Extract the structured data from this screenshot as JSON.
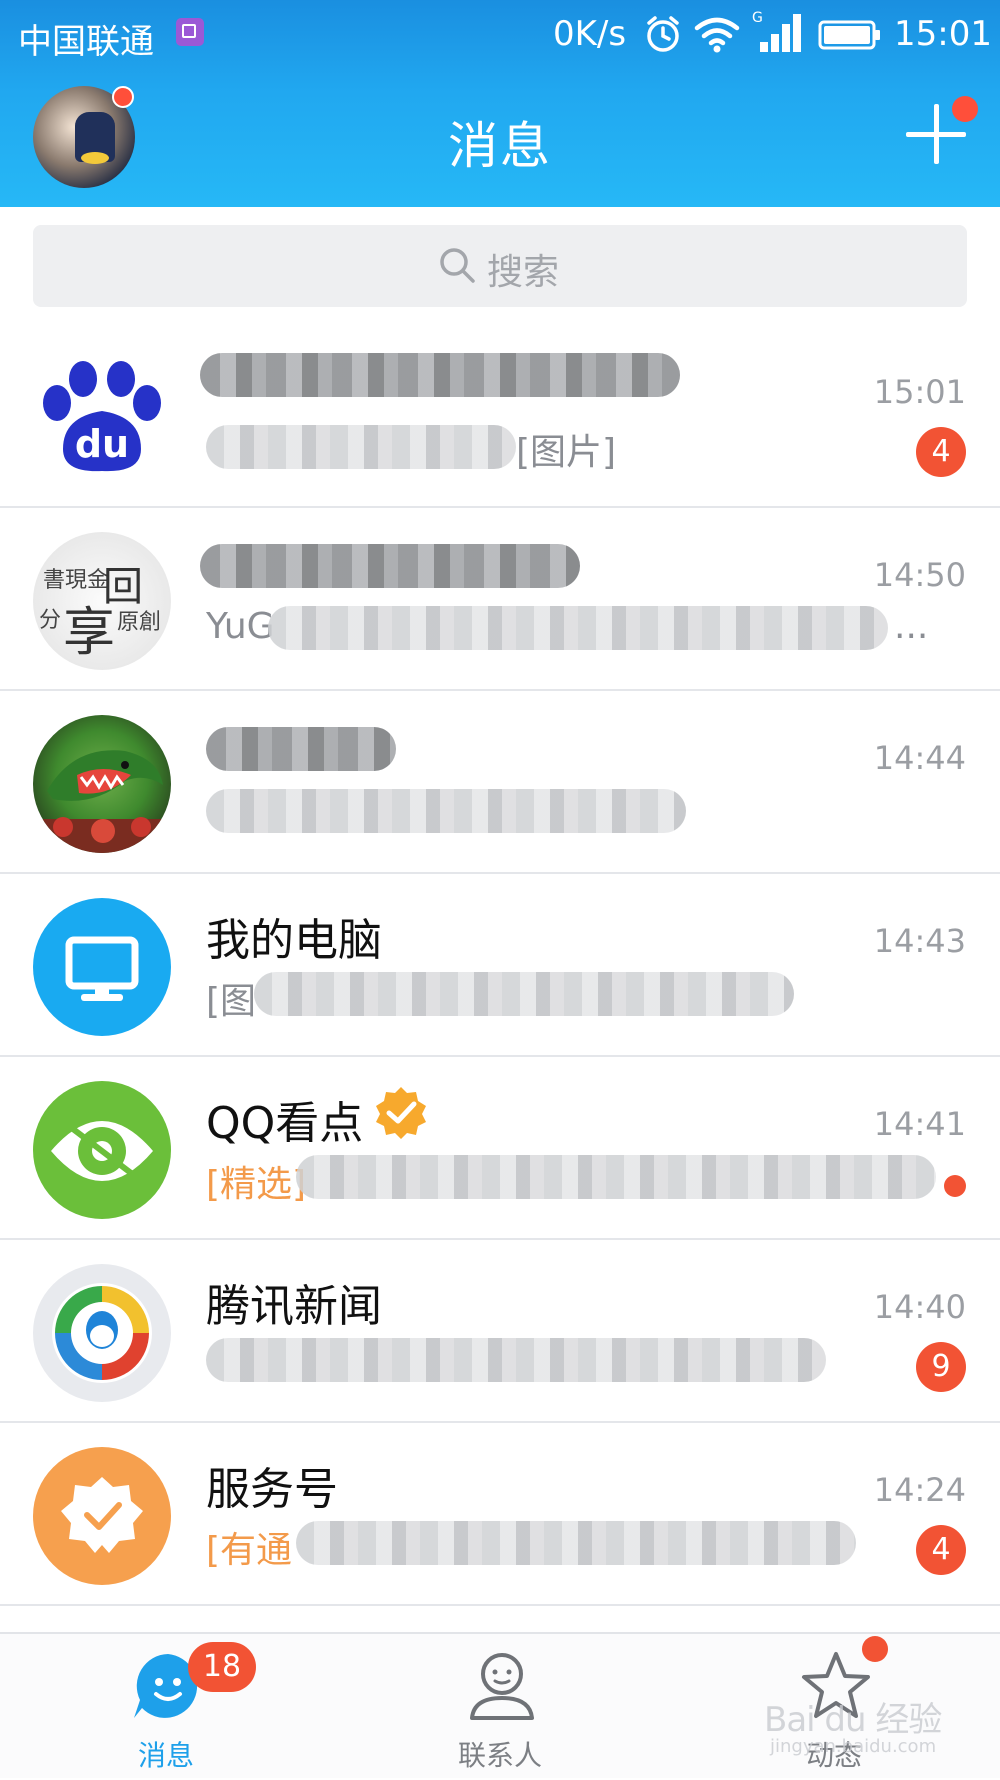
{
  "status_bar": {
    "carrier": "中国联通",
    "net_speed": "0K/s",
    "time": "15:01",
    "icons": [
      "photo-icon",
      "alarm-icon",
      "wifi-icon",
      "signal-icon",
      "battery-icon"
    ]
  },
  "header": {
    "title": "消息",
    "accent_color": "#26b8f6"
  },
  "search": {
    "placeholder": "搜索"
  },
  "conversations": [
    {
      "name": "",
      "preview_visible": "[图片]",
      "time": "15:01",
      "badge": "4",
      "avatar": "baidu-du-logo"
    },
    {
      "name": "",
      "preview_visible": "YuG",
      "preview_tail": "...",
      "time": "14:50",
      "badge": "",
      "avatar": "calligraphy-avatar"
    },
    {
      "name": "",
      "preview_visible": "",
      "time": "14:44",
      "badge": "",
      "avatar": "watermelon-shark-avatar"
    },
    {
      "name": "我的电脑",
      "preview_visible": "[图",
      "time": "14:43",
      "badge": "",
      "avatar": "computer-monitor-icon"
    },
    {
      "name": "QQ看点",
      "preview_visible": "[精选]",
      "time": "14:41",
      "badge": "",
      "dot": true,
      "verified": true,
      "avatar": "eye-icon"
    },
    {
      "name": "腾讯新闻",
      "preview_visible": "",
      "time": "14:40",
      "badge": "9",
      "avatar": "tencent-news-icon"
    },
    {
      "name": "服务号",
      "preview_visible": "[有通",
      "time": "14:24",
      "badge": "4",
      "avatar": "service-badge-icon"
    }
  ],
  "tabbar": {
    "messages_label": "消息",
    "messages_badge": "18",
    "contacts_label": "联系人",
    "feeds_label": "动态",
    "watermark": "Bai du 经验",
    "watermark_sub": "jingyan.baidu.com"
  }
}
